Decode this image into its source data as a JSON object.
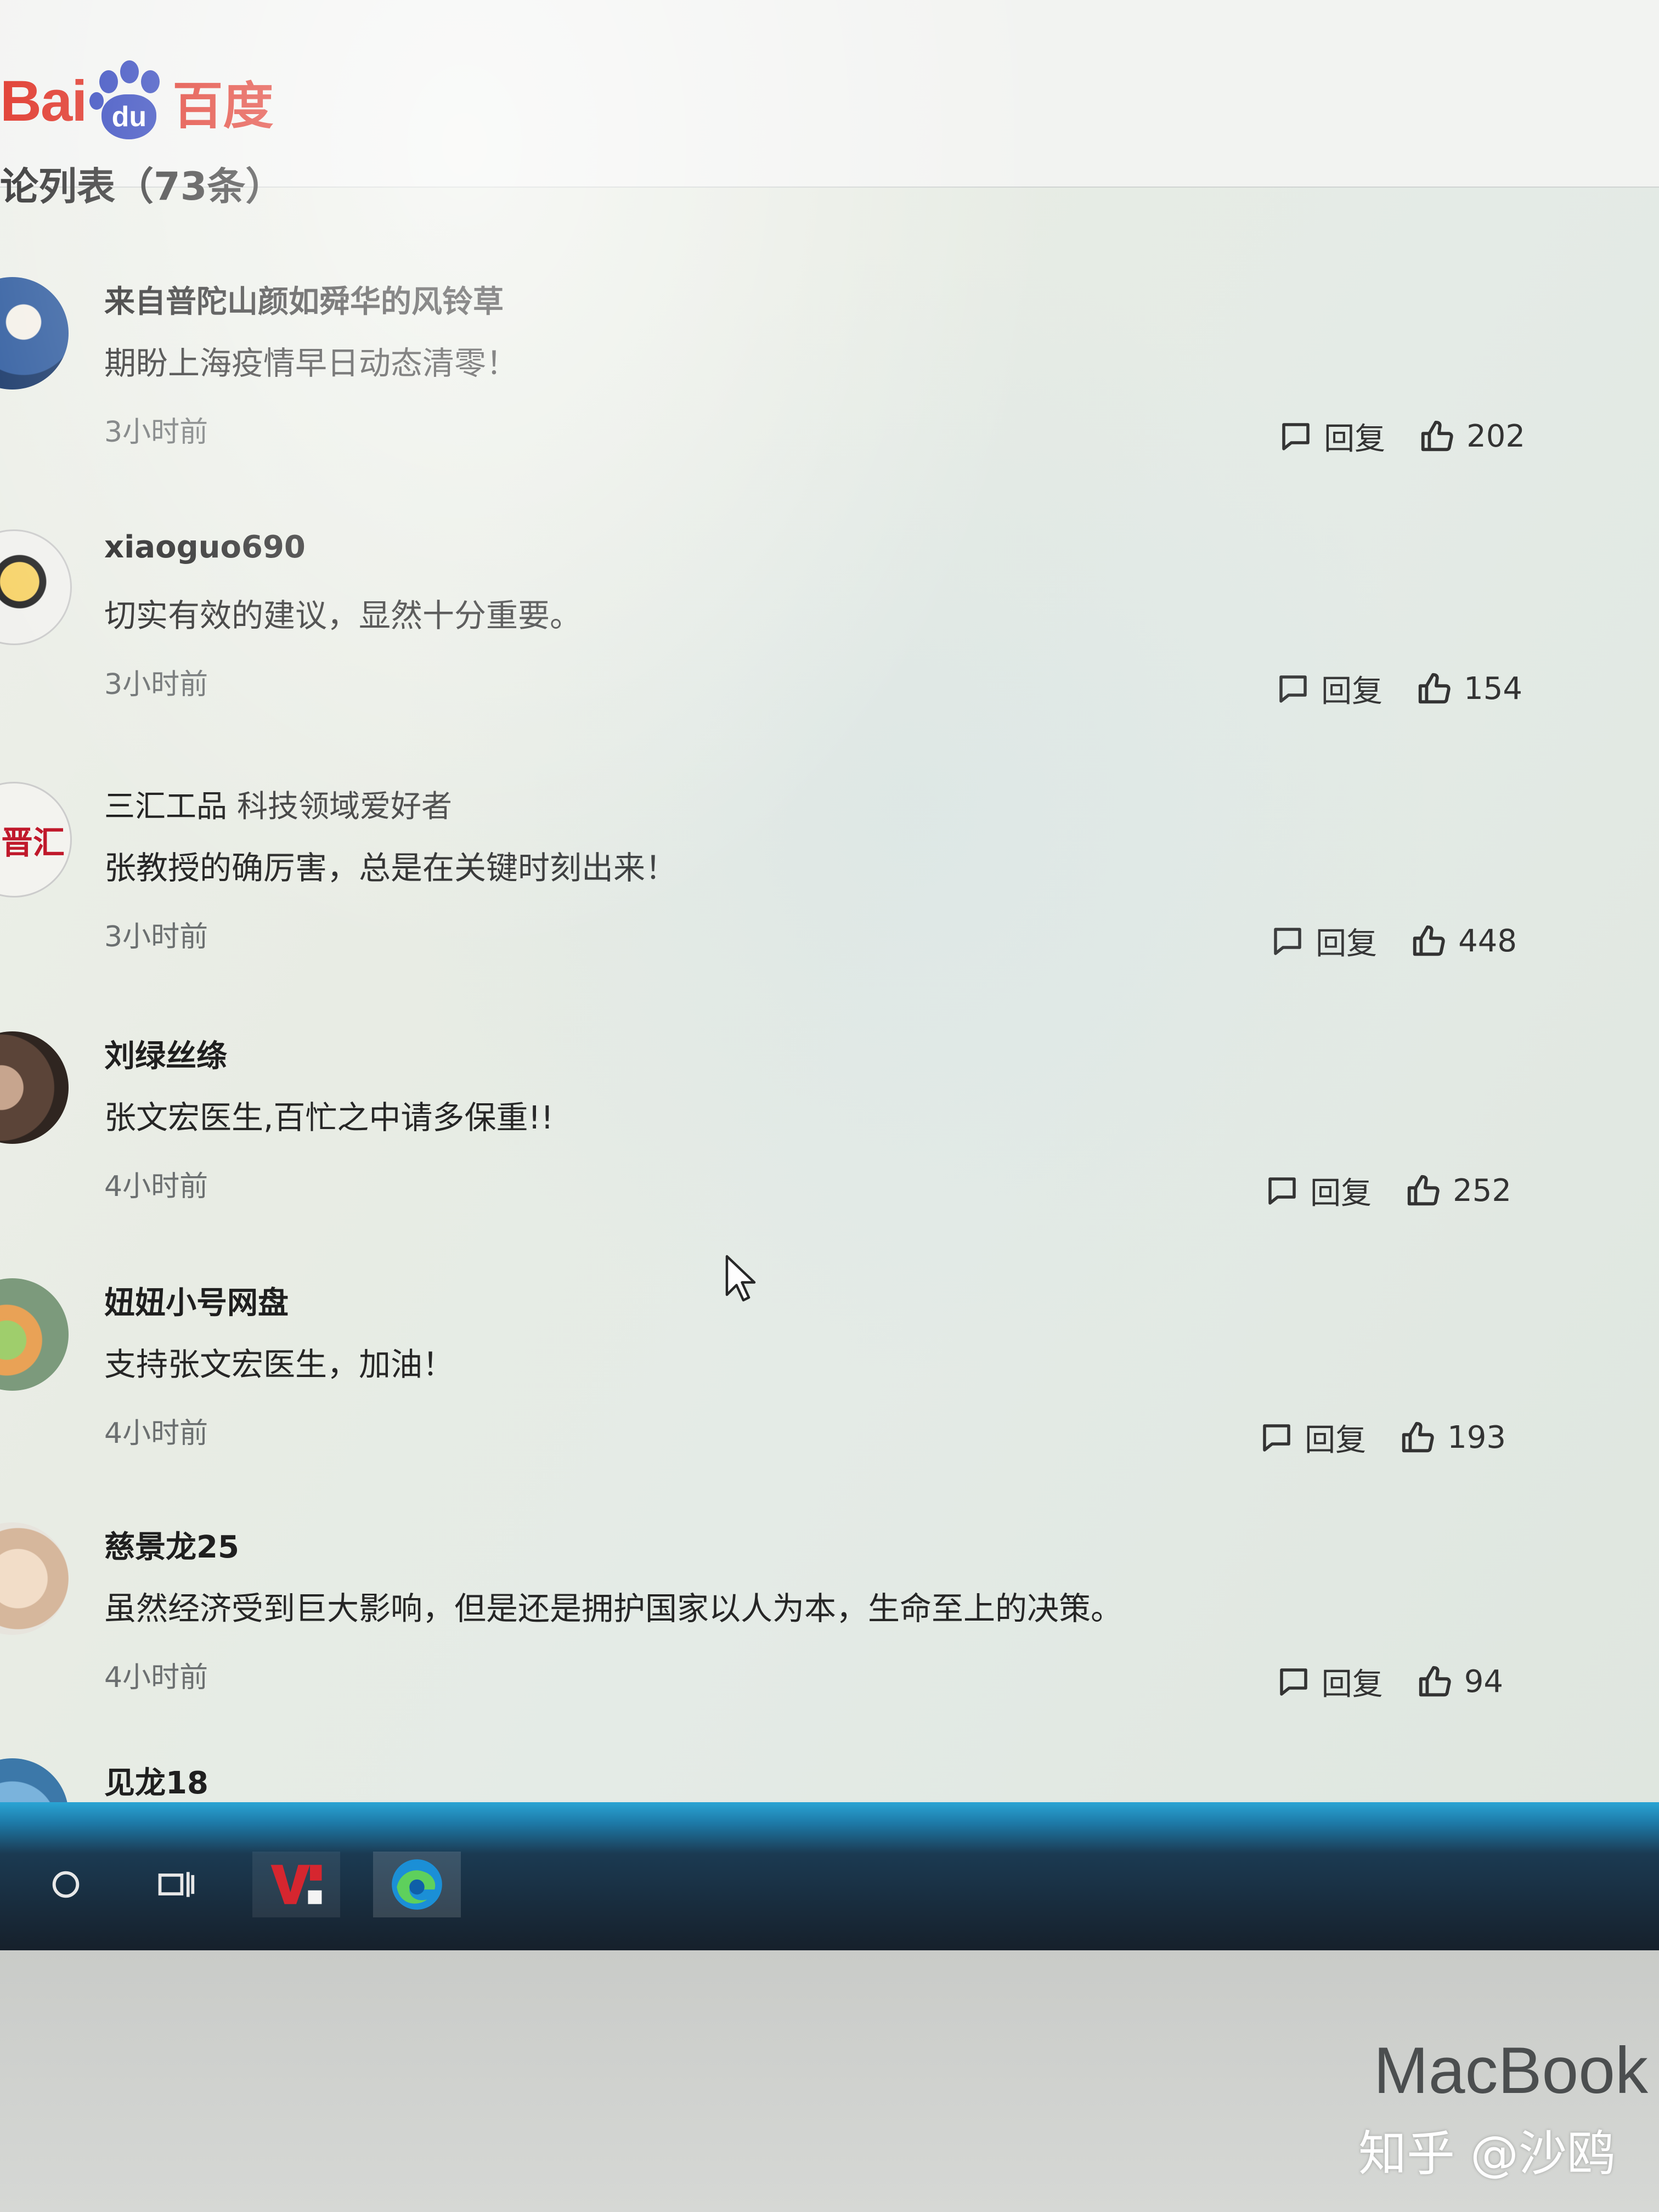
{
  "header": {
    "logo_left": "Bai",
    "logo_paw_text": "du",
    "logo_right": "百度",
    "section_title": "论列表（73条）"
  },
  "comments": [
    {
      "user": "来自普陀山颜如舜华的风铃草",
      "tag": "",
      "text": "期盼上海疫情早日动态清零！",
      "time": "3小时前",
      "reply": "回复",
      "likes": "202"
    },
    {
      "user": "xiaoguo690",
      "tag": "",
      "text": "切实有效的建议，显然十分重要。",
      "time": "3小时前",
      "reply": "回复",
      "likes": "154"
    },
    {
      "user": "三汇工品",
      "tag": "科技领域爱好者",
      "text": "张教授的确厉害，总是在关键时刻出来！",
      "time": "3小时前",
      "reply": "回复",
      "likes": "448"
    },
    {
      "user": "刘绿丝绦",
      "tag": "",
      "text": "张文宏医生,百忙之中请多保重!!",
      "time": "4小时前",
      "reply": "回复",
      "likes": "252"
    },
    {
      "user": "妞妞小号网盘",
      "tag": "",
      "text": "支持张文宏医生，加油！",
      "time": "4小时前",
      "reply": "回复",
      "likes": "193"
    },
    {
      "user": "慈景龙25",
      "tag": "",
      "text": "虽然经济受到巨大影响，但是还是拥护国家以人为本，生命至上的决策。",
      "time": "4小时前",
      "reply": "回复",
      "likes": "94"
    },
    {
      "user": "见龙18",
      "tag": "",
      "text": "",
      "time": "",
      "reply": "",
      "likes": ""
    }
  ],
  "avatar_text_3": "晋汇",
  "bezel": {
    "brand": "MacBook",
    "watermark": "知乎 @沙鸥"
  },
  "colors": {
    "baidu_red": "#de2a1d",
    "baidu_blue": "#2a3fbb",
    "taskbar_top": "#2aa4d4"
  }
}
